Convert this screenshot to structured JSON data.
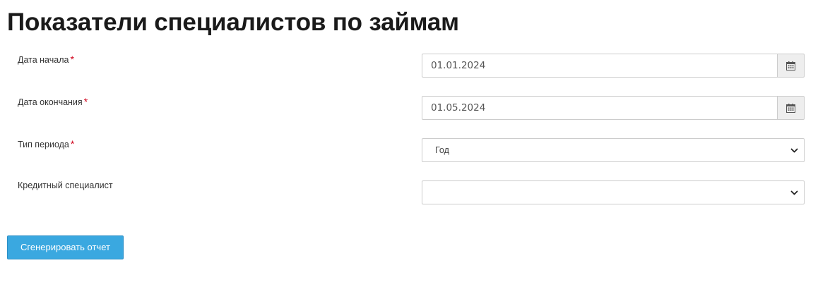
{
  "page": {
    "title": "Показатели специалистов по займам"
  },
  "form": {
    "required_mark": "*",
    "start_date": {
      "label": "Дата начала",
      "value": "01.01.2024",
      "icon": "calendar-icon"
    },
    "end_date": {
      "label": "Дата окончания",
      "value": "01.05.2024",
      "icon": "calendar-icon"
    },
    "period_type": {
      "label": "Тип периода",
      "selected": "Год",
      "icon": "chevron-down-icon"
    },
    "credit_specialist": {
      "label": "Кредитный специалист",
      "selected": "",
      "icon": "chevron-down-icon"
    }
  },
  "actions": {
    "generate_label": "Сгенерировать отчет"
  },
  "colors": {
    "primary_button": "#3aa8e0",
    "required_star": "#d0021b",
    "input_border": "#cccccc",
    "addon_background": "#eeeeee"
  }
}
